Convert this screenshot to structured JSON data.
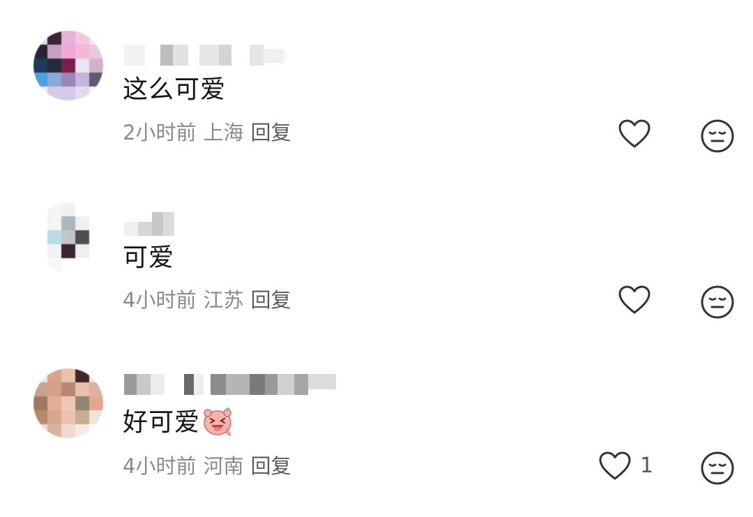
{
  "comments": [
    {
      "text": "这么可爱",
      "time": "2小时前",
      "location": "上海",
      "reply": "回复",
      "likes": "",
      "like_icon": "heart-outline-icon",
      "dislike_icon": "meh-face-icon"
    },
    {
      "text": "可爱",
      "time": "4小时前",
      "location": "江苏",
      "reply": "回复",
      "likes": "",
      "like_icon": "heart-outline-icon",
      "dislike_icon": "meh-face-icon"
    },
    {
      "text": "好可爱",
      "emoji": "laughing-pig-sticker",
      "time": "4小时前",
      "location": "河南",
      "reply": "回复",
      "likes": "1",
      "like_icon": "heart-outline-icon",
      "dislike_icon": "meh-face-icon"
    }
  ],
  "colors": {
    "text": "#151515",
    "meta": "#8a8a8a",
    "reply": "#5a5a5a",
    "icon": "#333333"
  }
}
